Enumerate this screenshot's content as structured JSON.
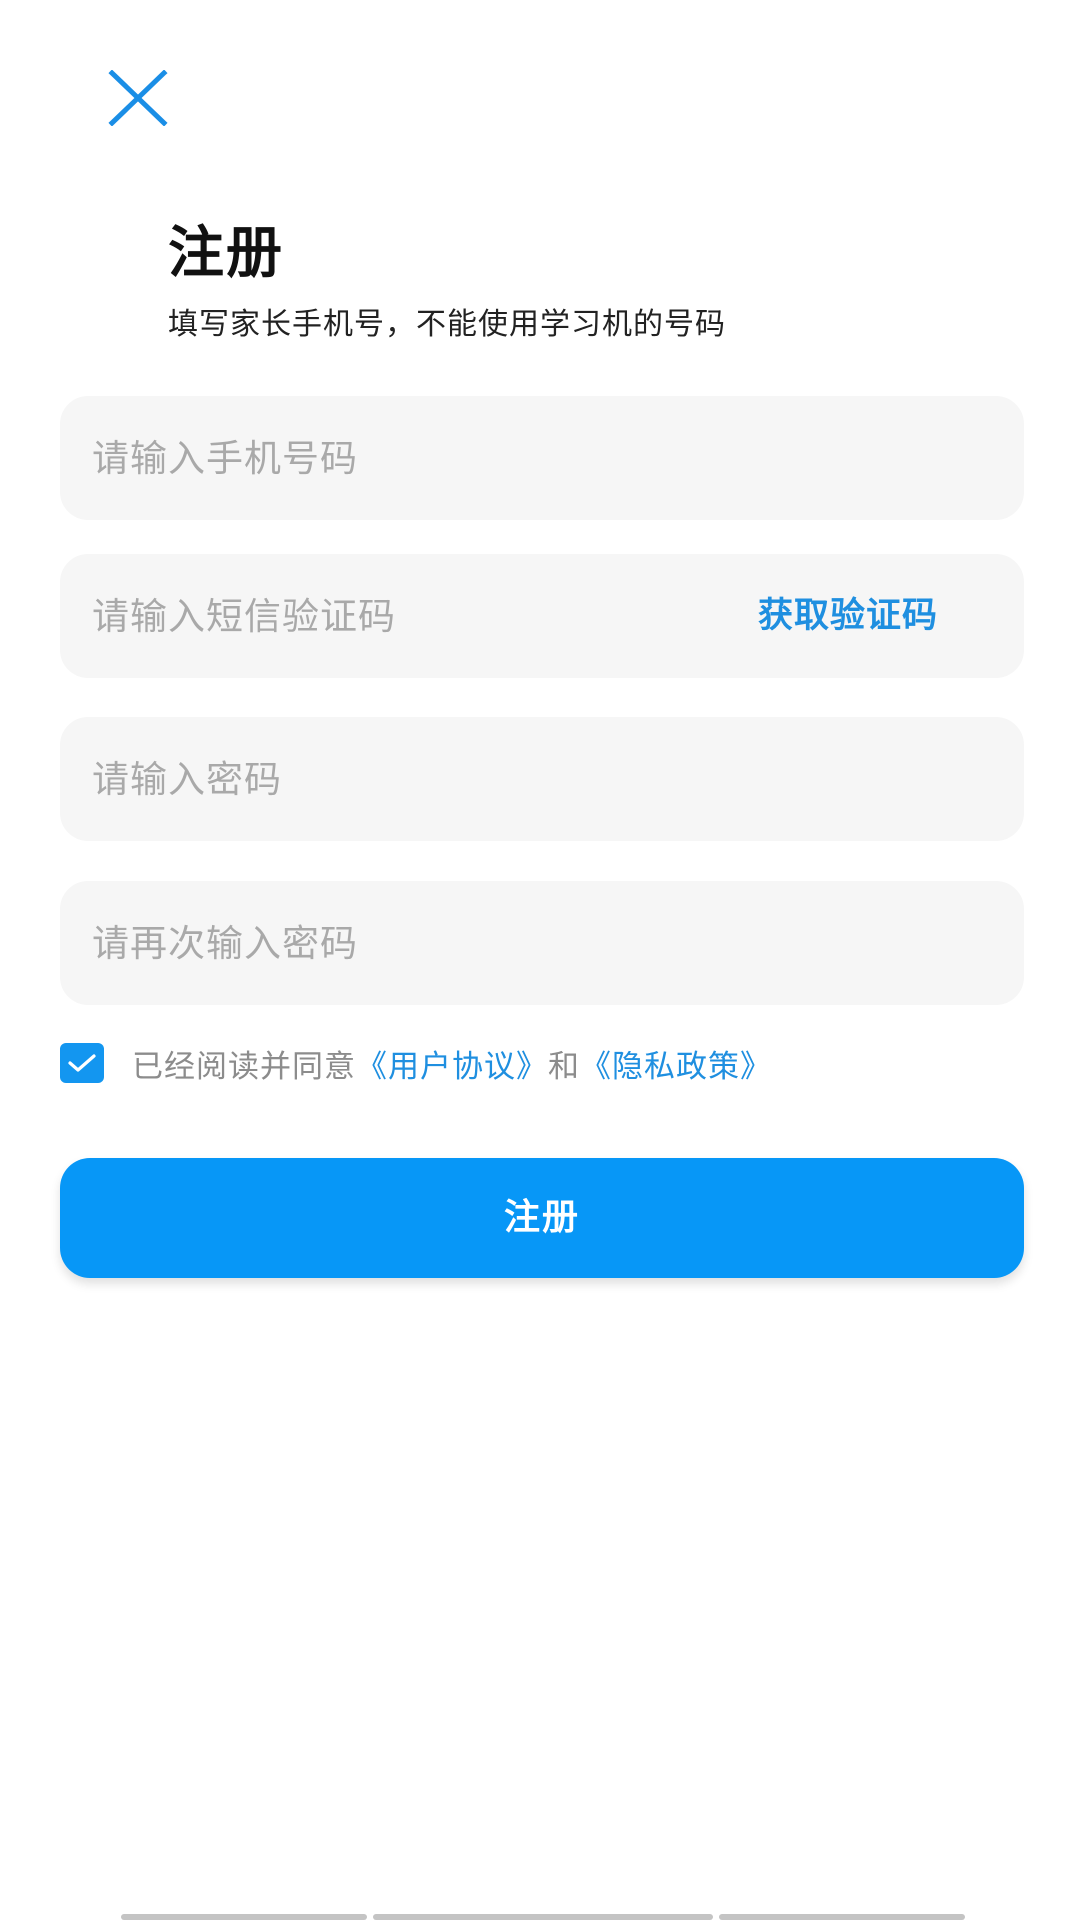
{
  "header": {
    "close_icon": "close-icon",
    "accent_color": "#0797f7",
    "title": "注册",
    "subtitle": "填写家长手机号，不能使用学习机的号码"
  },
  "form": {
    "phone_placeholder": "请输入手机号码",
    "sms_code_placeholder": "请输入短信验证码",
    "get_code_label": "获取验证码",
    "password_placeholder": "请输入密码",
    "confirm_password_placeholder": "请再次输入密码"
  },
  "agreement": {
    "checked": true,
    "prefix": "已经阅读并同意",
    "user_agreement": "《用户协议》",
    "joiner": "和",
    "privacy_policy": "《隐私政策》"
  },
  "submit_label": "注册"
}
